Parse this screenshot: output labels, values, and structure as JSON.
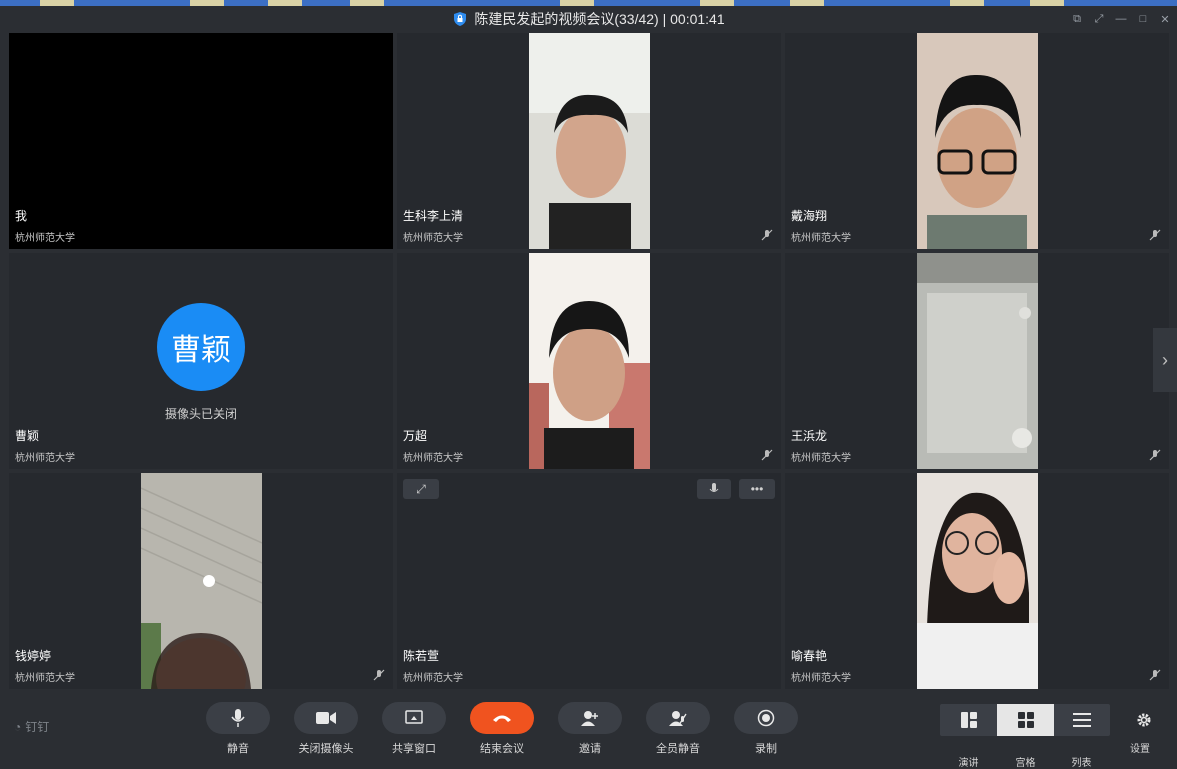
{
  "window": {
    "title": "陈建民发起的视频会议(33/42) | 00:01:41"
  },
  "tiles": [
    {
      "name": "我",
      "org": "杭州师范大学"
    },
    {
      "name": "生科李上清",
      "org": "杭州师范大学"
    },
    {
      "name": "戴海翔",
      "org": "杭州师范大学"
    },
    {
      "name": "曹颖",
      "org": "杭州师范大学",
      "avatar_text": "曹颖",
      "camera_status": "摄像头已关闭"
    },
    {
      "name": "万超",
      "org": "杭州师范大学"
    },
    {
      "name": "王浜龙",
      "org": "杭州师范大学"
    },
    {
      "name": "钱婷婷",
      "org": "杭州师范大学"
    },
    {
      "name": "陈若萱",
      "org": "杭州师范大学"
    },
    {
      "name": "喻春艳",
      "org": "杭州师范大学"
    }
  ],
  "toolbar": {
    "brand": "钉钉",
    "buttons": [
      {
        "label": "静音",
        "icon": "microphone-icon"
      },
      {
        "label": "关闭摄像头",
        "icon": "camera-icon"
      },
      {
        "label": "共享窗口",
        "icon": "share-screen-icon"
      },
      {
        "label": "结束会议",
        "icon": "hangup-icon"
      },
      {
        "label": "邀请",
        "icon": "add-user-icon"
      },
      {
        "label": "全员静音",
        "icon": "mute-all-icon"
      },
      {
        "label": "录制",
        "icon": "record-icon"
      }
    ],
    "views": [
      {
        "label": "演讲",
        "icon": "speaker-layout-icon"
      },
      {
        "label": "宫格",
        "icon": "grid-layout-icon"
      },
      {
        "label": "列表",
        "icon": "list-layout-icon"
      }
    ],
    "settings_label": "设置"
  },
  "colors": {
    "background": "#2b2e33",
    "tile": "#26292e",
    "avatar": "#1a8cf5",
    "end_call": "#f0531f"
  }
}
